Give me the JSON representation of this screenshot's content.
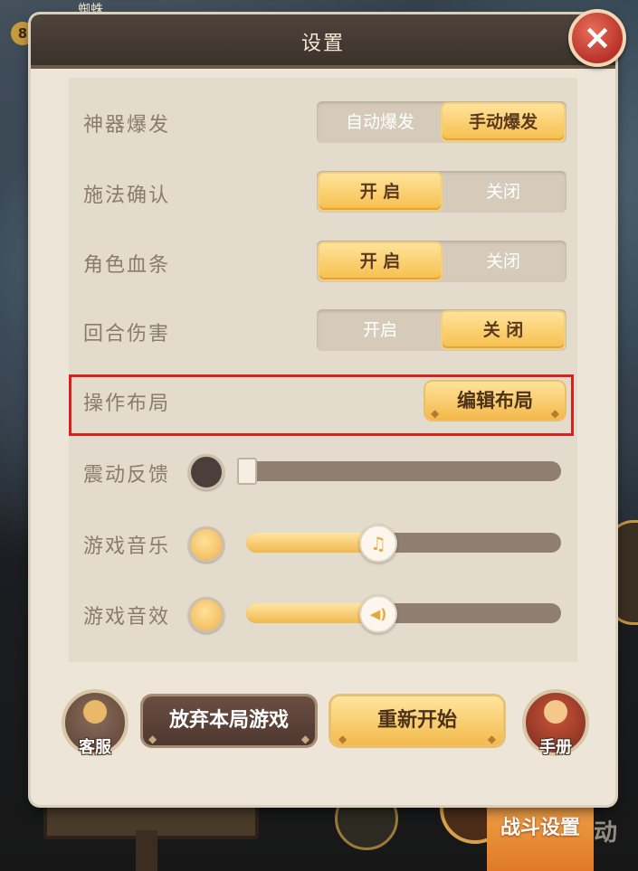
{
  "background": {
    "level_badge": "8",
    "player_name": "蜘蛛",
    "battle_settings_button": "战斗设置",
    "battle_settings_extra": "动"
  },
  "dialog": {
    "title": "设置",
    "close_icon": "×",
    "rows": [
      {
        "label": "神器爆发",
        "options": [
          "自动爆发",
          "手动爆发"
        ],
        "selected": 1
      },
      {
        "label": "施法确认",
        "options": [
          "开 启",
          "关闭"
        ],
        "selected": 0
      },
      {
        "label": "角色血条",
        "options": [
          "开 启",
          "关闭"
        ],
        "selected": 0
      },
      {
        "label": "回合伤害",
        "options": [
          "开启",
          "关 闭"
        ],
        "selected": 1
      }
    ],
    "layout_row": {
      "label": "操作布局",
      "button": "编辑布局"
    },
    "sliders": [
      {
        "label": "震动反馈",
        "level": 0.0,
        "thumb_icon": "square-handle"
      },
      {
        "label": "游戏音乐",
        "level": 0.4,
        "thumb_icon": "music-note-icon",
        "thumb_glyph": "♫"
      },
      {
        "label": "游戏音效",
        "level": 0.4,
        "thumb_icon": "speaker-icon",
        "thumb_glyph": "◀)"
      }
    ],
    "bottom": {
      "customer_service_label": "客服",
      "abandon_label": "放弃本局游戏",
      "restart_label": "重新开始",
      "handbook_label": "手册"
    }
  },
  "colors": {
    "accent_gold": "#f6bf4e",
    "highlight_red": "#d9201d",
    "title_bar": "#3b322c"
  }
}
